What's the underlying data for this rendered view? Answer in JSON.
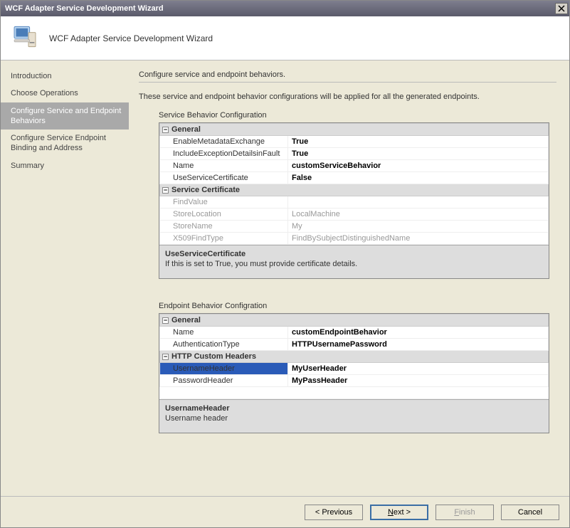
{
  "window": {
    "title": "WCF Adapter Service Development Wizard"
  },
  "header": {
    "title": "WCF Adapter Service Development Wizard"
  },
  "sidebar": {
    "items": [
      {
        "label": "Introduction"
      },
      {
        "label": "Choose Operations"
      },
      {
        "label": "Configure Service and Endpoint Behaviors"
      },
      {
        "label": "Configure Service Endpoint Binding and Address"
      },
      {
        "label": "Summary"
      }
    ]
  },
  "page": {
    "heading": "Configure service and endpoint behaviors.",
    "description": "These service and endpoint behavior configurations will be applied for all the generated endpoints."
  },
  "service_grid": {
    "label": "Service Behavior Configuration",
    "cat_general": "General",
    "rows": [
      {
        "name": "EnableMetadataExchange",
        "value": "True"
      },
      {
        "name": "IncludeExceptionDetailsinFault",
        "value": "True"
      },
      {
        "name": "Name",
        "value": "customServiceBehavior"
      },
      {
        "name": "UseServiceCertificate",
        "value": "False"
      }
    ],
    "cat_cert": "Service Certificate",
    "cert_rows": [
      {
        "name": "FindValue",
        "value": ""
      },
      {
        "name": "StoreLocation",
        "value": "LocalMachine"
      },
      {
        "name": "StoreName",
        "value": "My"
      },
      {
        "name": "X509FindType",
        "value": "FindBySubjectDistinguishedName"
      }
    ],
    "desc_title": "UseServiceCertificate",
    "desc_text": "If this is set to True, you must provide certificate details."
  },
  "endpoint_grid": {
    "label": "Endpoint Behavior Configration",
    "cat_general": "General",
    "rows": [
      {
        "name": "Name",
        "value": "customEndpointBehavior"
      },
      {
        "name": "AuthenticationType",
        "value": "HTTPUsernamePassword"
      }
    ],
    "cat_headers": "HTTP Custom Headers",
    "header_rows": [
      {
        "name": "UsernameHeader",
        "value": "MyUserHeader"
      },
      {
        "name": "PasswordHeader",
        "value": "MyPassHeader"
      }
    ],
    "desc_title": "UsernameHeader",
    "desc_text": "Username header"
  },
  "buttons": {
    "previous": "< Previous",
    "next_prefix": "N",
    "next_suffix": "ext >",
    "finish_prefix": "F",
    "finish_suffix": "inish",
    "cancel": "Cancel"
  }
}
